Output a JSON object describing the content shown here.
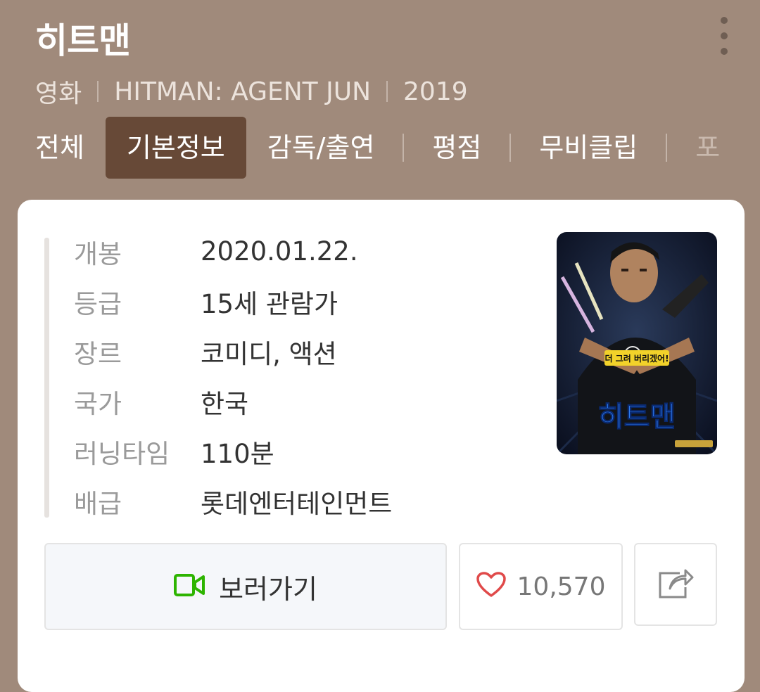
{
  "header": {
    "title": "히트맨",
    "category": "영화",
    "english_title": "HITMAN: AGENT JUN",
    "year": "2019"
  },
  "tabs": [
    {
      "label": "전체",
      "active": false
    },
    {
      "label": "기본정보",
      "active": true
    },
    {
      "label": "감독/출연",
      "active": false
    },
    {
      "label": "평점",
      "active": false
    },
    {
      "label": "무비클립",
      "active": false
    },
    {
      "label": "포",
      "active": false
    }
  ],
  "info": [
    {
      "key": "개봉",
      "value": "2020.01.22."
    },
    {
      "key": "등급",
      "value": "15세 관람가"
    },
    {
      "key": "장르",
      "value": "코미디, 액션"
    },
    {
      "key": "국가",
      "value": "한국"
    },
    {
      "key": "러닝타임",
      "value": "110분"
    },
    {
      "key": "배급",
      "value": "롯데엔터테인먼트"
    }
  ],
  "poster": {
    "title_text": "히트맨",
    "tagline": "더 그려 버리겠어!"
  },
  "actions": {
    "watch_label": "보러가기",
    "like_count": "10,570"
  },
  "colors": {
    "header_bg": "#a08a7b",
    "active_tab_bg": "#674937",
    "watch_icon": "#2db400",
    "heart_icon": "#e04a4a"
  },
  "icons": {
    "more": "more-vertical-icon",
    "watch": "video-camera-icon",
    "like": "heart-icon",
    "share": "share-icon"
  }
}
